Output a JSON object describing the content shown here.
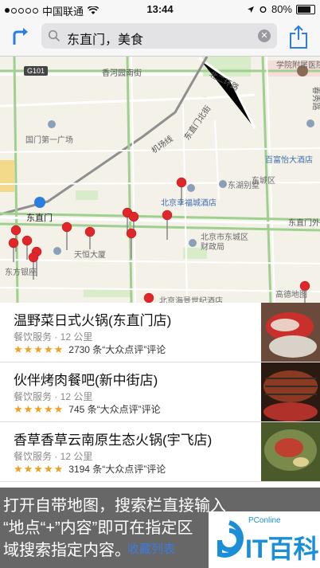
{
  "status_bar": {
    "carrier": "中国联通",
    "time": "13:44",
    "battery": "80%",
    "battery_level": 0.8
  },
  "toolbar": {
    "search_value": "东直门，美食"
  },
  "map": {
    "road_labels": [
      "G101",
      "香河园南街",
      "北二环路",
      "东直门北街",
      "机场线",
      "东城区",
      "东直门外大街",
      "东直门"
    ],
    "place_labels": [
      "国门第一广场",
      "北京幸福城酒店",
      "东湖别墅",
      "百富怡大酒店",
      "天恒大厦",
      "北京市东城区财政局",
      "东方银座",
      "北京海景世纪酒店",
      "高德地图",
      "学院附属医院",
      "春秀路"
    ]
  },
  "results": [
    {
      "name": "温野菜日式火锅(东直门店)",
      "category": "餐饮服务 · 12 公里",
      "stars": "★★★★★",
      "reviews": "2730 条“大众点评”评论"
    },
    {
      "name": "伙伴烤肉餐吧(新中街店)",
      "category": "餐饮服务 · 12 公里",
      "stars": "★★★★★",
      "reviews": "745 条“大众点评”评论"
    },
    {
      "name": "香草香草云南原生态火锅(宇飞店)",
      "category": "餐饮服务 · 12 公里",
      "stars": "★★★★★",
      "reviews": "3194 条“大众点评”评论"
    }
  ],
  "caption": {
    "line1": "打开自带地图，搜索栏直接输入",
    "line2": "“地点“+”内容”即可在指定区",
    "line3": "域搜索指定内容。"
  },
  "bookmark_label": "收藏列表",
  "brand": {
    "pconline": "PConline",
    "name": "IT百科"
  }
}
